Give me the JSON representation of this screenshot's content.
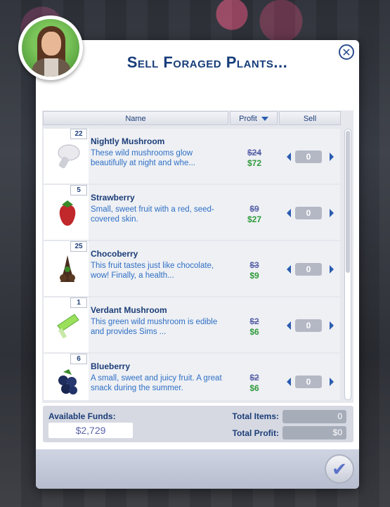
{
  "dialog": {
    "title": "Sell Foraged Plants...",
    "close_icon": "close-icon",
    "confirm_icon": "checkmark-icon"
  },
  "table": {
    "columns": [
      {
        "label": "Name"
      },
      {
        "label": "Profit",
        "sort_indicator": "chevron-down-icon"
      },
      {
        "label": "Sell"
      }
    ],
    "rows": [
      {
        "count": "22",
        "name": "Nightly Mushroom",
        "description": "These wild mushrooms glow beautifully at night and whe...",
        "old_price": "$24",
        "new_price": "$72",
        "sell_qty": "0",
        "icon": "mushroom-icon"
      },
      {
        "count": "5",
        "name": "Strawberry",
        "description": "Small, sweet fruit with a red, seed-covered skin.",
        "old_price": "$9",
        "new_price": "$27",
        "sell_qty": "0",
        "icon": "strawberry-icon"
      },
      {
        "count": "25",
        "name": "Chocoberry",
        "description": "This fruit tastes just like chocolate, wow! Finally, a health...",
        "old_price": "$3",
        "new_price": "$9",
        "sell_qty": "0",
        "icon": "chocoberry-icon"
      },
      {
        "count": "1",
        "name": "Verdant Mushroom",
        "description": "This green wild mushroom is edible and provides Sims ...",
        "old_price": "$2",
        "new_price": "$6",
        "sell_qty": "0",
        "icon": "mushroom-icon"
      },
      {
        "count": "6",
        "name": "Blueberry",
        "description": "A small, sweet and juicy fruit. A great snack during the summer.",
        "old_price": "$2",
        "new_price": "$6",
        "sell_qty": "0",
        "icon": "blueberry-icon"
      }
    ]
  },
  "summary": {
    "funds_label": "Available Funds:",
    "funds_value": "$2,729",
    "total_items_label": "Total Items:",
    "total_items_value": "0",
    "total_profit_label": "Total Profit:",
    "total_profit_value": "$0"
  },
  "colors": {
    "title": "#173d7a",
    "new_price": "#2f9a3a",
    "old_price": "#5b64a8",
    "desc": "#2f6fc4"
  }
}
